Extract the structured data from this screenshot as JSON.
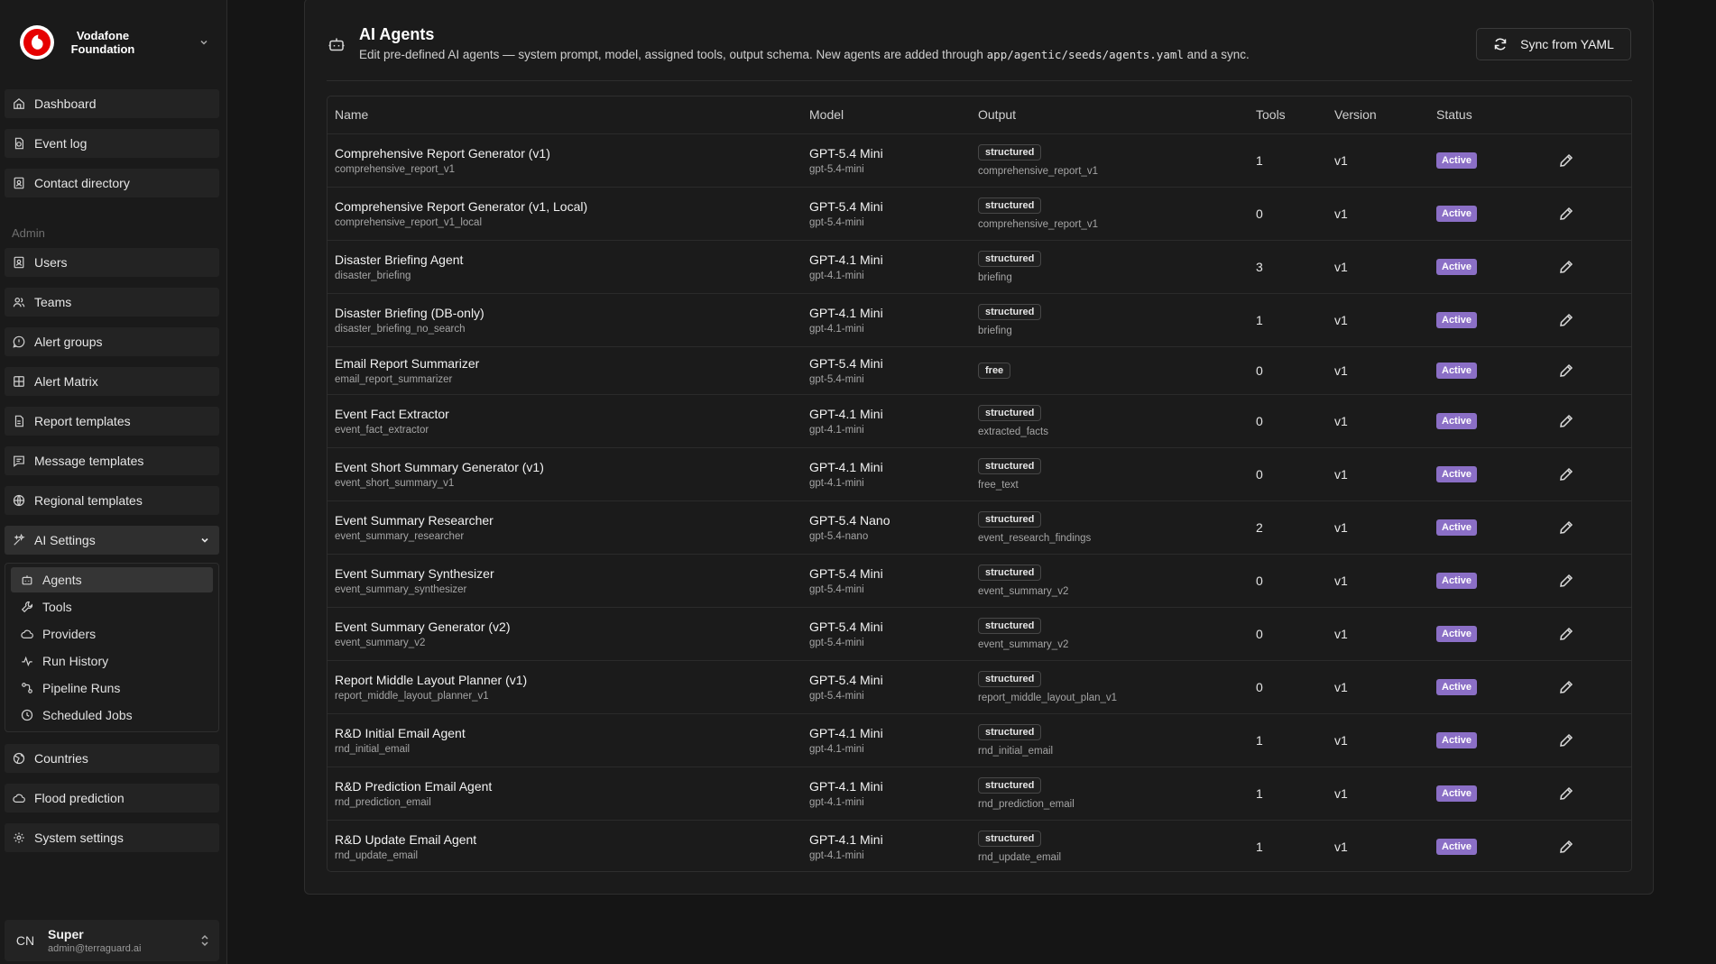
{
  "brand": {
    "name_line1": "Vodafone",
    "name_line2": "Foundation"
  },
  "nav": {
    "top": [
      {
        "label": "Dashboard",
        "icon": "home-icon"
      },
      {
        "label": "Event log",
        "icon": "event-log-icon"
      },
      {
        "label": "Contact directory",
        "icon": "contact-icon"
      }
    ],
    "admin_label": "Admin",
    "admin": [
      {
        "label": "Users",
        "icon": "users-icon"
      },
      {
        "label": "Teams",
        "icon": "teams-icon"
      },
      {
        "label": "Alert groups",
        "icon": "alert-groups-icon"
      },
      {
        "label": "Alert Matrix",
        "icon": "grid-icon"
      },
      {
        "label": "Report templates",
        "icon": "report-icon"
      },
      {
        "label": "Message templates",
        "icon": "message-icon"
      },
      {
        "label": "Regional templates",
        "icon": "globe-icon"
      },
      {
        "label": "AI Settings",
        "icon": "sparkles-icon"
      }
    ],
    "ai_sub": [
      {
        "label": "Agents",
        "icon": "bot-icon"
      },
      {
        "label": "Tools",
        "icon": "wrench-icon"
      },
      {
        "label": "Providers",
        "icon": "cloud-icon"
      },
      {
        "label": "Run History",
        "icon": "activity-icon"
      },
      {
        "label": "Pipeline Runs",
        "icon": "pipeline-icon"
      },
      {
        "label": "Scheduled Jobs",
        "icon": "clock-icon"
      }
    ],
    "bottom": [
      {
        "label": "Countries",
        "icon": "earth-icon"
      },
      {
        "label": "Flood prediction",
        "icon": "cloud-icon"
      },
      {
        "label": "System settings",
        "icon": "gear-icon"
      }
    ]
  },
  "user": {
    "initials": "CN",
    "name": "Super",
    "email": "admin@terraguard.ai"
  },
  "page": {
    "title": "AI Agents",
    "desc_before": "Edit pre-defined AI agents — system prompt, model, assigned tools, output schema. New agents are added through ",
    "desc_code": "app/agentic/seeds/agents.yaml",
    "desc_after": " and a sync.",
    "sync_label": "Sync from YAML"
  },
  "table": {
    "headers": [
      "Name",
      "Model",
      "Output",
      "Tools",
      "Version",
      "Status"
    ],
    "rows": [
      {
        "name": "Comprehensive Report Generator (v1)",
        "slug": "comprehensive_report_v1",
        "model": "GPT-5.4 Mini",
        "model_id": "gpt-5.4-mini",
        "output": "structured",
        "output_name": "comprehensive_report_v1",
        "tools": "1",
        "version": "v1",
        "status": "Active"
      },
      {
        "name": "Comprehensive Report Generator (v1, Local)",
        "slug": "comprehensive_report_v1_local",
        "model": "GPT-5.4 Mini",
        "model_id": "gpt-5.4-mini",
        "output": "structured",
        "output_name": "comprehensive_report_v1",
        "tools": "0",
        "version": "v1",
        "status": "Active"
      },
      {
        "name": "Disaster Briefing Agent",
        "slug": "disaster_briefing",
        "model": "GPT-4.1 Mini",
        "model_id": "gpt-4.1-mini",
        "output": "structured",
        "output_name": "briefing",
        "tools": "3",
        "version": "v1",
        "status": "Active"
      },
      {
        "name": "Disaster Briefing (DB-only)",
        "slug": "disaster_briefing_no_search",
        "model": "GPT-4.1 Mini",
        "model_id": "gpt-4.1-mini",
        "output": "structured",
        "output_name": "briefing",
        "tools": "1",
        "version": "v1",
        "status": "Active"
      },
      {
        "name": "Email Report Summarizer",
        "slug": "email_report_summarizer",
        "model": "GPT-5.4 Mini",
        "model_id": "gpt-5.4-mini",
        "output": "free",
        "output_name": "",
        "tools": "0",
        "version": "v1",
        "status": "Active"
      },
      {
        "name": "Event Fact Extractor",
        "slug": "event_fact_extractor",
        "model": "GPT-4.1 Mini",
        "model_id": "gpt-4.1-mini",
        "output": "structured",
        "output_name": "extracted_facts",
        "tools": "0",
        "version": "v1",
        "status": "Active"
      },
      {
        "name": "Event Short Summary Generator (v1)",
        "slug": "event_short_summary_v1",
        "model": "GPT-4.1 Mini",
        "model_id": "gpt-4.1-mini",
        "output": "structured",
        "output_name": "free_text",
        "tools": "0",
        "version": "v1",
        "status": "Active"
      },
      {
        "name": "Event Summary Researcher",
        "slug": "event_summary_researcher",
        "model": "GPT-5.4 Nano",
        "model_id": "gpt-5.4-nano",
        "output": "structured",
        "output_name": "event_research_findings",
        "tools": "2",
        "version": "v1",
        "status": "Active"
      },
      {
        "name": "Event Summary Synthesizer",
        "slug": "event_summary_synthesizer",
        "model": "GPT-5.4 Mini",
        "model_id": "gpt-5.4-mini",
        "output": "structured",
        "output_name": "event_summary_v2",
        "tools": "0",
        "version": "v1",
        "status": "Active"
      },
      {
        "name": "Event Summary Generator (v2)",
        "slug": "event_summary_v2",
        "model": "GPT-5.4 Mini",
        "model_id": "gpt-5.4-mini",
        "output": "structured",
        "output_name": "event_summary_v2",
        "tools": "0",
        "version": "v1",
        "status": "Active"
      },
      {
        "name": "Report Middle Layout Planner (v1)",
        "slug": "report_middle_layout_planner_v1",
        "model": "GPT-5.4 Mini",
        "model_id": "gpt-5.4-mini",
        "output": "structured",
        "output_name": "report_middle_layout_plan_v1",
        "tools": "0",
        "version": "v1",
        "status": "Active"
      },
      {
        "name": "R&D Initial Email Agent",
        "slug": "rnd_initial_email",
        "model": "GPT-4.1 Mini",
        "model_id": "gpt-4.1-mini",
        "output": "structured",
        "output_name": "rnd_initial_email",
        "tools": "1",
        "version": "v1",
        "status": "Active"
      },
      {
        "name": "R&D Prediction Email Agent",
        "slug": "rnd_prediction_email",
        "model": "GPT-4.1 Mini",
        "model_id": "gpt-4.1-mini",
        "output": "structured",
        "output_name": "rnd_prediction_email",
        "tools": "1",
        "version": "v1",
        "status": "Active"
      },
      {
        "name": "R&D Update Email Agent",
        "slug": "rnd_update_email",
        "model": "GPT-4.1 Mini",
        "model_id": "gpt-4.1-mini",
        "output": "structured",
        "output_name": "rnd_update_email",
        "tools": "1",
        "version": "v1",
        "status": "Active"
      }
    ]
  },
  "colors": {
    "accent": "#8b6fc6",
    "brand_red": "#e60000"
  }
}
